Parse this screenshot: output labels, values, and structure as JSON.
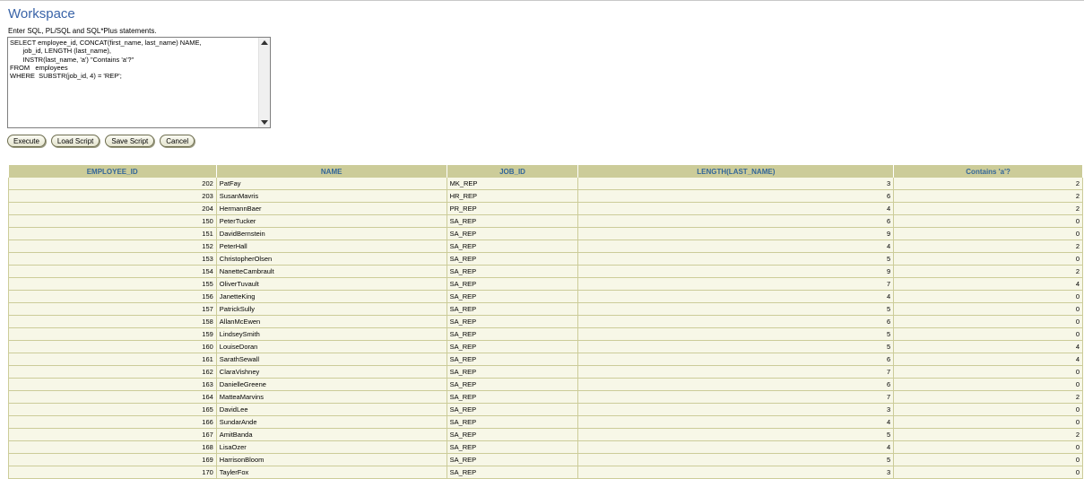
{
  "page": {
    "title": "Workspace",
    "instruction": "Enter SQL, PL/SQL and SQL*Plus statements."
  },
  "editor": {
    "sql": "SELECT employee_id, CONCAT(first_name, last_name) NAME,\n       job_id, LENGTH (last_name),\n       INSTR(last_name, 'a') \"Contains 'a'?\"\nFROM   employees\nWHERE  SUBSTR(job_id, 4) = 'REP';"
  },
  "buttons": {
    "execute": "Execute",
    "load": "Load Script",
    "save": "Save Script",
    "cancel": "Cancel"
  },
  "results": {
    "columns": [
      "EMPLOYEE_ID",
      "NAME",
      "JOB_ID",
      "LENGTH(LAST_NAME)",
      "Contains 'a'?"
    ],
    "rows": [
      [
        "202",
        "PatFay",
        "MK_REP",
        "3",
        "2"
      ],
      [
        "203",
        "SusanMavris",
        "HR_REP",
        "6",
        "2"
      ],
      [
        "204",
        "HermannBaer",
        "PR_REP",
        "4",
        "2"
      ],
      [
        "150",
        "PeterTucker",
        "SA_REP",
        "6",
        "0"
      ],
      [
        "151",
        "DavidBernstein",
        "SA_REP",
        "9",
        "0"
      ],
      [
        "152",
        "PeterHall",
        "SA_REP",
        "4",
        "2"
      ],
      [
        "153",
        "ChristopherOlsen",
        "SA_REP",
        "5",
        "0"
      ],
      [
        "154",
        "NanetteCambrault",
        "SA_REP",
        "9",
        "2"
      ],
      [
        "155",
        "OliverTuvault",
        "SA_REP",
        "7",
        "4"
      ],
      [
        "156",
        "JanetteKing",
        "SA_REP",
        "4",
        "0"
      ],
      [
        "157",
        "PatrickSully",
        "SA_REP",
        "5",
        "0"
      ],
      [
        "158",
        "AllanMcEwen",
        "SA_REP",
        "6",
        "0"
      ],
      [
        "159",
        "LindseySmith",
        "SA_REP",
        "5",
        "0"
      ],
      [
        "160",
        "LouiseDoran",
        "SA_REP",
        "5",
        "4"
      ],
      [
        "161",
        "SarathSewall",
        "SA_REP",
        "6",
        "4"
      ],
      [
        "162",
        "ClaraVishney",
        "SA_REP",
        "7",
        "0"
      ],
      [
        "163",
        "DanielleGreene",
        "SA_REP",
        "6",
        "0"
      ],
      [
        "164",
        "MatteaMarvins",
        "SA_REP",
        "7",
        "2"
      ],
      [
        "165",
        "DavidLee",
        "SA_REP",
        "3",
        "0"
      ],
      [
        "166",
        "SundarAnde",
        "SA_REP",
        "4",
        "0"
      ],
      [
        "167",
        "AmitBanda",
        "SA_REP",
        "5",
        "2"
      ],
      [
        "168",
        "LisaOzer",
        "SA_REP",
        "4",
        "0"
      ],
      [
        "169",
        "HarrisonBloom",
        "SA_REP",
        "5",
        "0"
      ],
      [
        "170",
        "TaylerFox",
        "SA_REP",
        "3",
        "0"
      ]
    ]
  },
  "colors": {
    "title": "#3a64a8",
    "header_bg": "#cccc99",
    "header_text": "#336699",
    "row_bg": "#f7f7e7"
  }
}
